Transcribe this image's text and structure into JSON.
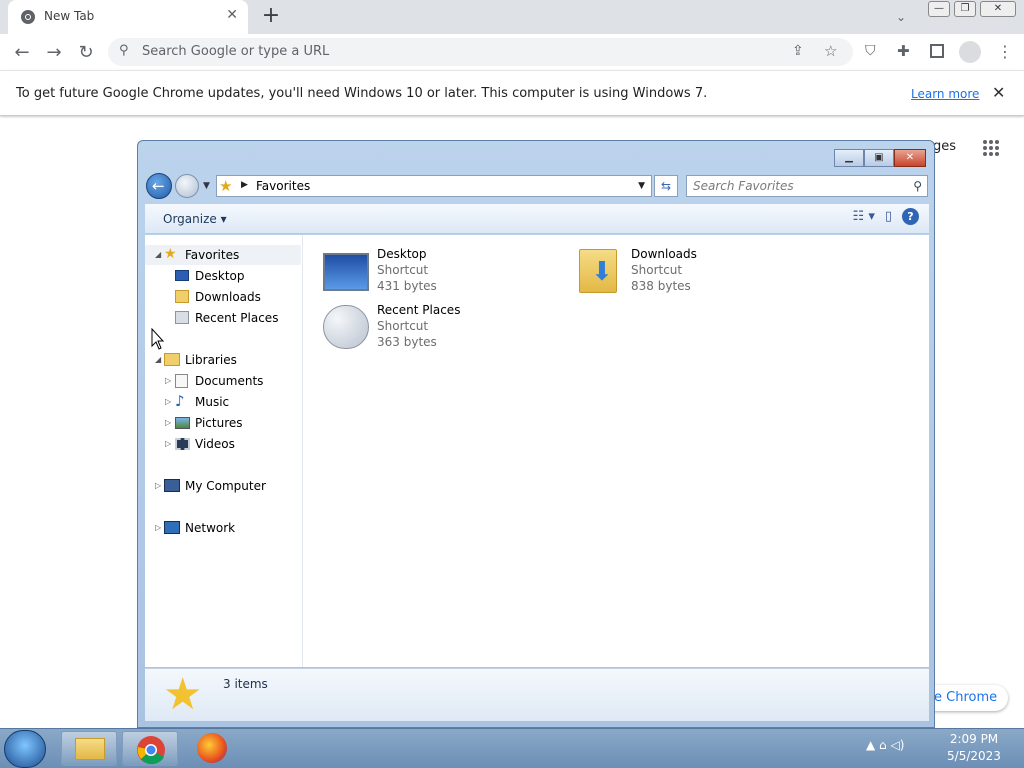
{
  "chrome": {
    "tab_title": "New Tab",
    "tab_close": "✕",
    "new_tab": "+",
    "minimize": "—",
    "restore": "❐",
    "close": "✕",
    "omnibox_placeholder": "Search Google or type a URL",
    "infobar_message": "To get future Google Chrome updates, you'll need Windows 10 or later. This computer is using Windows 7.",
    "learn_more": "Learn more",
    "infobar_close": "✕",
    "bg_images_partial": "ges",
    "bg_chrome_partial": "e Chrome"
  },
  "explorer": {
    "address": "Favorites",
    "search_placeholder": "Search Favorites",
    "organize": "Organize ▾",
    "nav": {
      "favorites": "Favorites",
      "desktop": "Desktop",
      "downloads": "Downloads",
      "recent_places": "Recent Places",
      "libraries": "Libraries",
      "documents": "Documents",
      "music": "Music",
      "pictures": "Pictures",
      "videos": "Videos",
      "my_computer": "My Computer",
      "network": "Network"
    },
    "files": [
      {
        "name": "Desktop",
        "type": "Shortcut",
        "size": "431 bytes"
      },
      {
        "name": "Downloads",
        "type": "Shortcut",
        "size": "838 bytes"
      },
      {
        "name": "Recent Places",
        "type": "Shortcut",
        "size": "363 bytes"
      }
    ],
    "status": "3 items"
  },
  "taskbar": {
    "time": "2:09 PM",
    "date": "5/5/2023"
  }
}
